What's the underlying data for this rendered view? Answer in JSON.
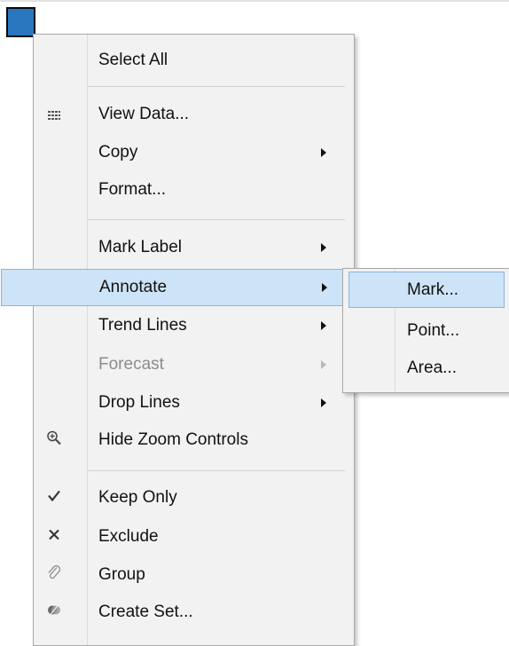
{
  "context_menu": {
    "items": [
      {
        "label": "Select All",
        "icon": "",
        "submenu": false,
        "disabled": false
      },
      {
        "label": "View Data...",
        "icon": "view-data-icon",
        "submenu": false,
        "disabled": false
      },
      {
        "label": "Copy",
        "icon": "",
        "submenu": true,
        "disabled": false
      },
      {
        "label": "Format...",
        "icon": "",
        "submenu": false,
        "disabled": false
      },
      {
        "label": "Mark Label",
        "icon": "",
        "submenu": true,
        "disabled": false
      },
      {
        "label": "Annotate",
        "icon": "",
        "submenu": true,
        "disabled": false,
        "highlighted": true
      },
      {
        "label": "Trend Lines",
        "icon": "",
        "submenu": true,
        "disabled": false
      },
      {
        "label": "Forecast",
        "icon": "",
        "submenu": true,
        "disabled": true
      },
      {
        "label": "Drop Lines",
        "icon": "",
        "submenu": true,
        "disabled": false
      },
      {
        "label": "Hide Zoom Controls",
        "icon": "zoom-icon",
        "submenu": false,
        "disabled": false
      },
      {
        "label": "Keep Only",
        "icon": "checkmark-icon",
        "submenu": false,
        "disabled": false
      },
      {
        "label": "Exclude",
        "icon": "x-icon",
        "submenu": false,
        "disabled": false
      },
      {
        "label": "Group",
        "icon": "paperclip-icon",
        "submenu": false,
        "disabled": false
      },
      {
        "label": "Create Set...",
        "icon": "set-icon",
        "submenu": false,
        "disabled": false
      }
    ]
  },
  "annotate_submenu": {
    "items": [
      {
        "label": "Mark...",
        "highlighted": true
      },
      {
        "label": "Point...",
        "highlighted": false
      },
      {
        "label": "Area...",
        "highlighted": false
      }
    ]
  },
  "colors": {
    "highlight": "#cde3f7",
    "highlight_border": "#8ab4dc",
    "menu_bg": "#f2f2f2",
    "mark": "#2a77c0"
  }
}
